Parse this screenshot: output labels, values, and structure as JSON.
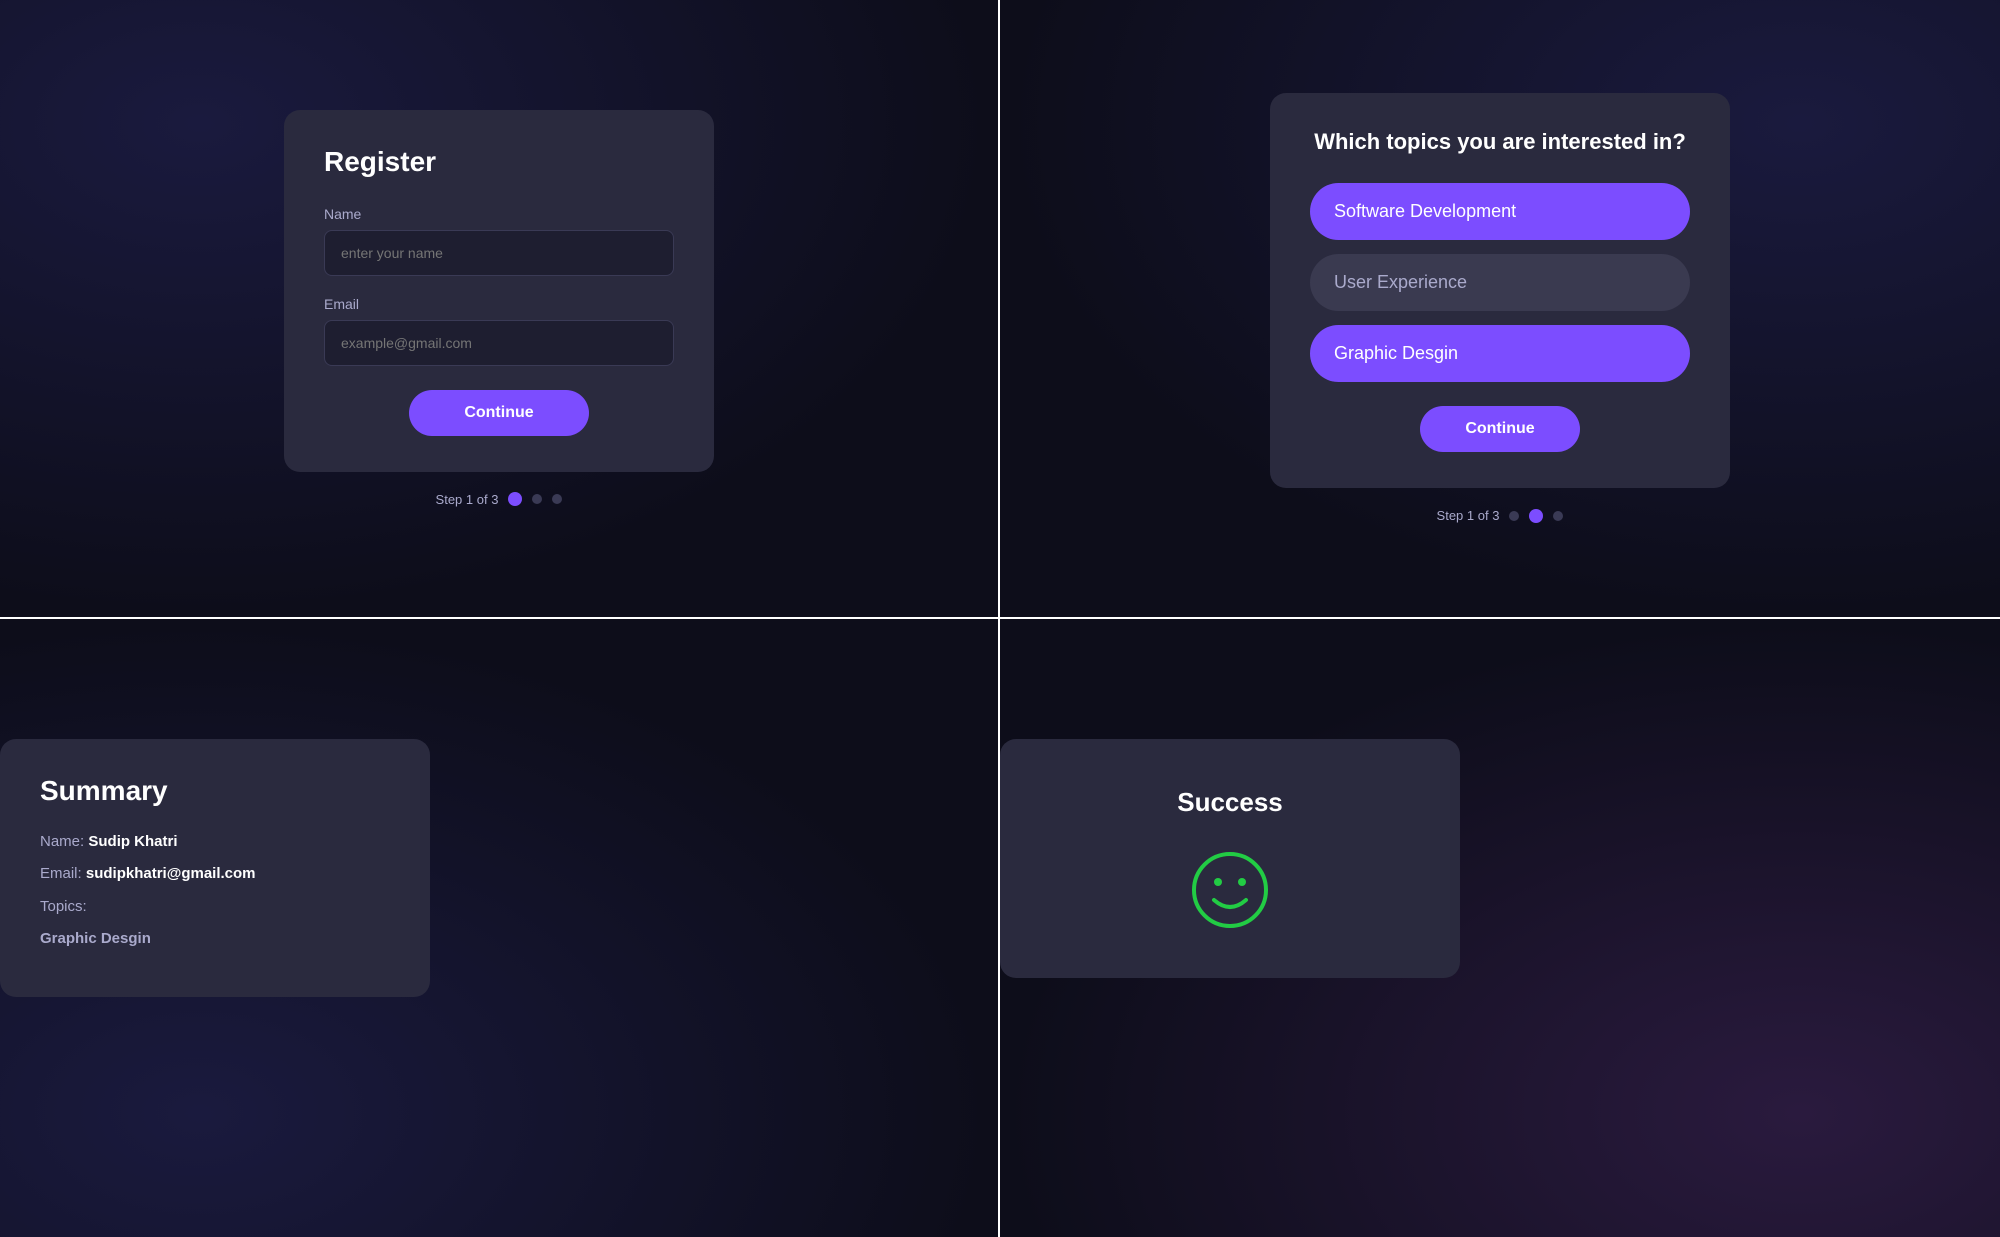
{
  "topLeft": {
    "card": {
      "title": "Register",
      "nameLabel": "Name",
      "namePlaceholder": "enter your name",
      "emailLabel": "Email",
      "emailPlaceholder": "example@gmail.com",
      "continueButton": "Continue",
      "stepText": "Step 1 of 3"
    }
  },
  "topRight": {
    "card": {
      "question": "Which topics you are interested in?",
      "topics": [
        {
          "label": "Software Development",
          "selected": true
        },
        {
          "label": "User Experience",
          "selected": false
        },
        {
          "label": "Graphic Desgin",
          "selected": true
        }
      ],
      "continueButton": "Continue",
      "stepText": "Step 1 of 3"
    }
  },
  "bottomLeft": {
    "card": {
      "title": "Summary",
      "nameLabel": "Name:",
      "nameValue": "Sudip Khatri",
      "emailLabel": "Email:",
      "emailValue": "sudipkhatri@gmail.com",
      "topicsLabel": "Topics:",
      "topicsValue": "Graphic Desgin"
    }
  },
  "bottomRight": {
    "card": {
      "title": "Success",
      "smileyColor": "#22cc44"
    }
  },
  "stepDots": {
    "dot1Active": "active",
    "dot2Active": "active",
    "dot3Inactive": "inactive"
  }
}
